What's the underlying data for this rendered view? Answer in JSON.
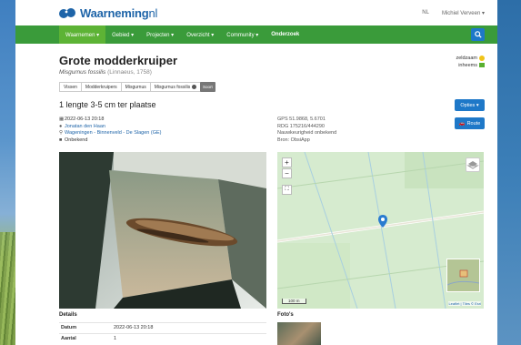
{
  "brand": {
    "name": "Waarneming",
    "tld": "nl",
    "color": "#1e64a8"
  },
  "topbar": {
    "lang": "NL",
    "user": "Michiel Verveen ▾"
  },
  "nav": {
    "items": [
      "Waarnemen ▾",
      "Gebied ▾",
      "Projecten ▾",
      "Overzicht ▾",
      "Community ▾",
      "Onderzoek"
    ],
    "active_index": 0,
    "accent": "#3a9b3a"
  },
  "species": {
    "title": "Grote modderkruiper",
    "scientific": "Misgurnus fossilis",
    "author": "(Linnaeus, 1758)"
  },
  "badges": {
    "status1": "zeldzaam",
    "status2": "inheems"
  },
  "tabs": [
    "Vissen",
    "Modderkruipers",
    "Misgurnus",
    "Misgurnus fossilis"
  ],
  "tab_extra": "Soort",
  "observation": {
    "count_text": "1 lengte 3-5 cm ter plaatse",
    "datetime": "2022-06-13 20:18",
    "observer": "Jonatan den Haan",
    "location": "Wageningen - Binnenveld - De Slagen (GE)",
    "status": "Onbekend"
  },
  "meta": {
    "gps": "GPS 51.9868, 5.6701",
    "rd": "RDG 175216/444290",
    "accuracy": "Nauwkeurigheid onbekend",
    "source": "Bron: ObsiApp"
  },
  "buttons": {
    "options": "Opties ▾",
    "route": "Route"
  },
  "map": {
    "scale": "100 m",
    "attribution": "Leaflet | Tiles © Esri"
  },
  "details": {
    "heading": "Details",
    "rows": [
      {
        "k": "Datum",
        "v": "2022-06-13 20:18"
      },
      {
        "k": "Aantal",
        "v": "1"
      }
    ]
  },
  "photos_heading": "Foto's"
}
